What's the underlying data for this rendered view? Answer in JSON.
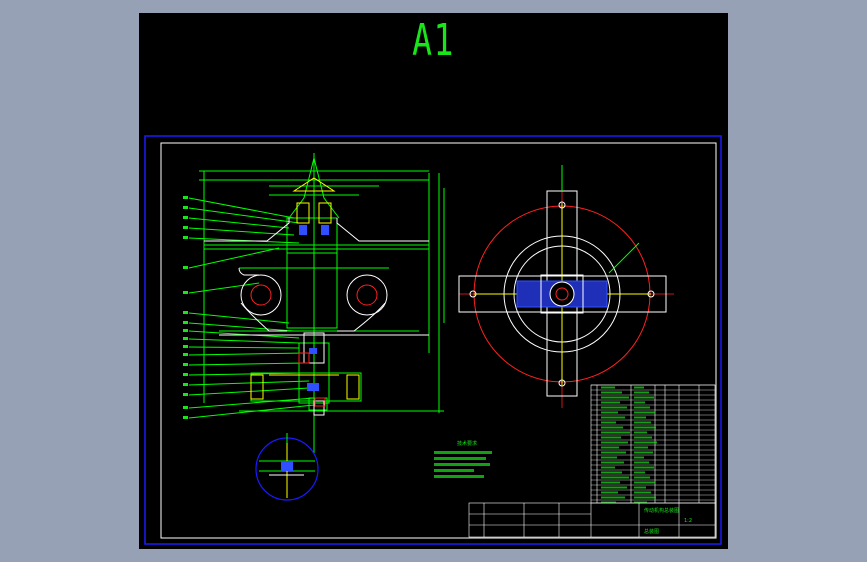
{
  "sheet": {
    "size_label": "A1",
    "title_block_text": "传动机构总装图",
    "drawing_no": "总装图",
    "scale": "1:2",
    "notes_heading": "技术要求"
  },
  "colors": {
    "background": "#96a1b5",
    "canvas": "#000000",
    "frame": "#1a1aff",
    "inner_frame": "#ffffff",
    "line_green": "#00ff00",
    "line_yellow": "#ffff00",
    "line_red": "#ff2020",
    "hatch_blue": "#3050ff",
    "text_green": "#19e619"
  },
  "icons": {
    "detail_view": "circle-detail",
    "plan_view": "circular-plan"
  }
}
